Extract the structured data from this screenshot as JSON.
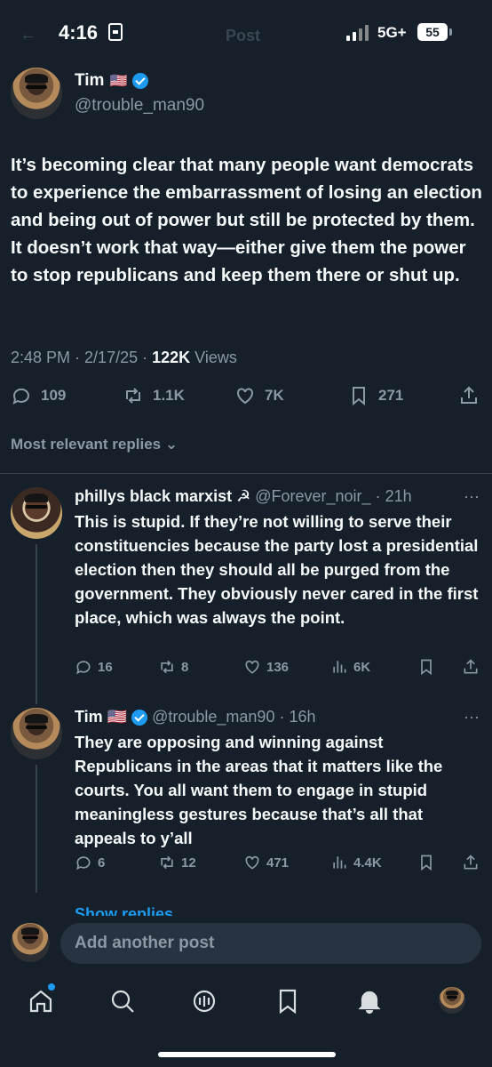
{
  "status_bar": {
    "time": "4:16",
    "network": "5G+",
    "battery": "55"
  },
  "header": {
    "title": "Post"
  },
  "post": {
    "author_name": "Tim",
    "author_flag": "🇺🇸",
    "author_handle": "@trouble_man90",
    "text": "It’s becoming clear that many people want democrats to experience the embarrassment of losing an election and being out of power but still be protected by them. It doesn’t work that way—either give them the power to stop republicans and keep them there or shut up.",
    "time": "2:48 PM",
    "date": "2/17/25",
    "views_count": "122K",
    "views_label": "Views",
    "replies": "109",
    "reposts": "1.1K",
    "likes": "7K",
    "bookmarks": "271"
  },
  "replies_sort": {
    "label": "Most relevant replies"
  },
  "replies": [
    {
      "name": "phillys black marxist ☭",
      "handle": "@Forever_noir_",
      "time": "21h",
      "text": "This is stupid. If they’re not willing to serve their constituencies because the party lost a presidential election then they should all be purged from the government. They obviously never cared in the first place, which was always the point.",
      "replies": "16",
      "reposts": "8",
      "likes": "136",
      "views": "6K"
    },
    {
      "name": "Tim 🇺🇸",
      "handle": "@trouble_man90",
      "time": "16h",
      "text": "They are opposing and winning against Republicans in the areas that it matters like the courts. You all want them to engage in stupid meaningless gestures because that’s all that appeals to y’all",
      "replies": "6",
      "reposts": "12",
      "likes": "471",
      "views": "4.4K"
    }
  ],
  "show_replies": "Show replies",
  "composer": {
    "placeholder": "Add another post"
  },
  "icons": {
    "tabs": [
      "home-icon",
      "search-icon",
      "grok-icon",
      "bookmark-icon",
      "notifications-icon",
      "profile-avatar"
    ]
  },
  "colors": {
    "background": "#15202b",
    "accent": "#1d9bf0",
    "muted": "#8b98a5"
  }
}
